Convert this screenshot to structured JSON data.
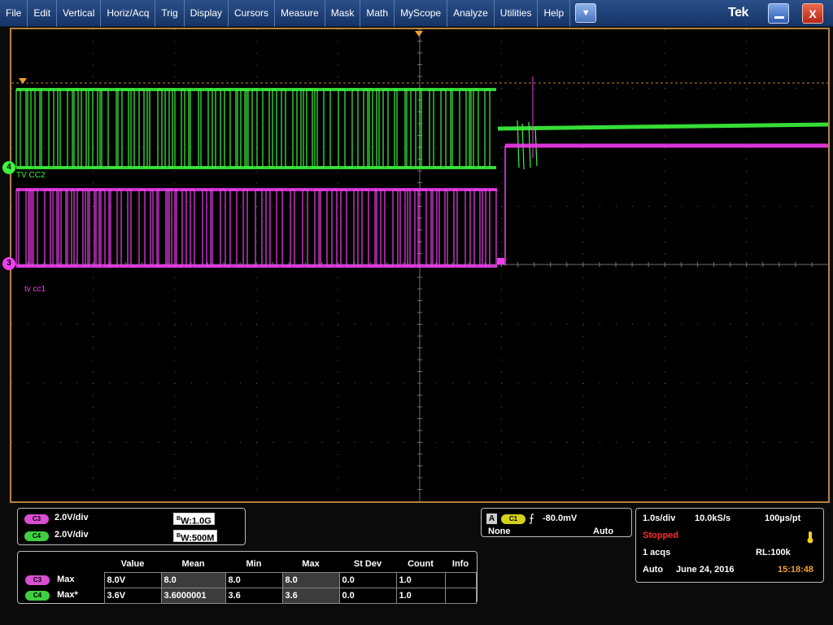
{
  "menu": {
    "items": [
      "File",
      "Edit",
      "Vertical",
      "Horiz/Acq",
      "Trig",
      "Display",
      "Cursors",
      "Measure",
      "Mask",
      "Math",
      "MyScope",
      "Analyze",
      "Utilities",
      "Help"
    ],
    "dropdown_glyph": "▼",
    "logo": "Tek",
    "close_glyph": "X"
  },
  "display": {
    "colors": {
      "ch4": "#3cf53c",
      "ch3": "#f03ef0",
      "trigger": "#f0a030",
      "grid": "#5a5a5a",
      "frame": "#b8823a"
    },
    "ch4_marker": "4",
    "ch3_marker": "3",
    "ch4_label": "TV CC2",
    "ch3_label": "tv cc1"
  },
  "channels": [
    {
      "badge": "C3",
      "scale": "2.0V/div",
      "bw_prefix": "B",
      "bw_suffix": "W",
      "bw": ":1.0G"
    },
    {
      "badge": "C4",
      "scale": "2.0V/div",
      "bw_prefix": "B",
      "bw_suffix": "W",
      "bw": ":500M"
    }
  ],
  "trigger": {
    "source_letter": "A",
    "source_badge": "C1",
    "edge_glyph": "⨍",
    "level": "-80.0mV",
    "coupling": "None",
    "mode": "Auto"
  },
  "acquisition": {
    "timebase": "1.0s/div",
    "sample_rate": "10.0kS/s",
    "resolution": "100µs/pt",
    "status": "Stopped",
    "acqs": "1 acqs",
    "record_length": "RL:100k",
    "mode": "Auto",
    "date": "June 24, 2016",
    "time": "15:18:48"
  },
  "measurements": {
    "headers": [
      "Value",
      "Mean",
      "Min",
      "Max",
      "St Dev",
      "Count",
      "Info"
    ],
    "rows": [
      {
        "badge": "C3",
        "name": "Max",
        "values": [
          "8.0V",
          "8.0",
          "8.0",
          "8.0",
          "0.0",
          "1.0",
          ""
        ]
      },
      {
        "badge": "C4",
        "name": "Max*",
        "values": [
          "3.6V",
          "3.6000001",
          "3.6",
          "3.6",
          "0.0",
          "1.0",
          ""
        ]
      }
    ]
  }
}
